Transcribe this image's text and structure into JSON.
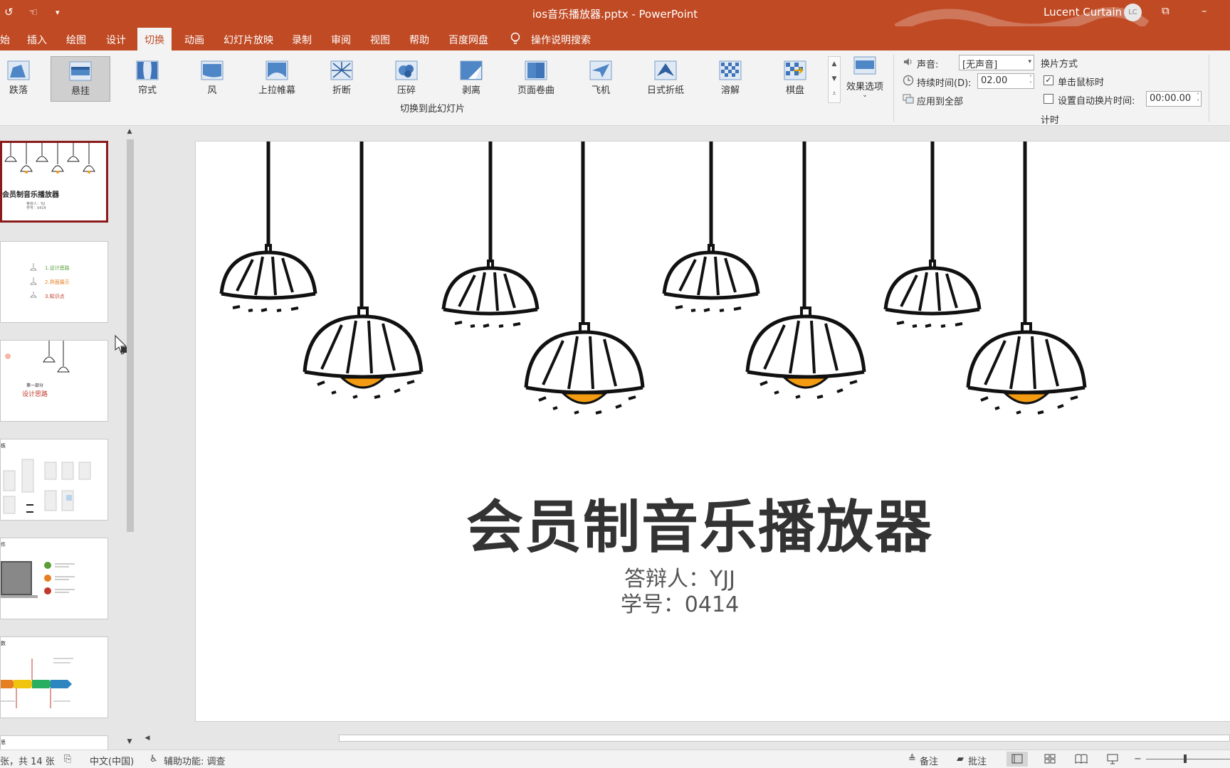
{
  "window": {
    "title": "ios音乐播放器.pptx  -  PowerPoint",
    "user_name": "Lucent Curtain",
    "user_initials": "LC",
    "brand_color": "#c04a24"
  },
  "quick_access": {
    "redo_icon": "redo-icon",
    "touch_mode_icon": "touch-mode-icon",
    "customize_icon": "chevron-down-icon"
  },
  "tabs": [
    {
      "label": "始"
    },
    {
      "label": "插入"
    },
    {
      "label": "绘图"
    },
    {
      "label": "设计"
    },
    {
      "label": "切换"
    },
    {
      "label": "动画"
    },
    {
      "label": "幻灯片放映"
    },
    {
      "label": "录制"
    },
    {
      "label": "审阅"
    },
    {
      "label": "视图"
    },
    {
      "label": "帮助"
    },
    {
      "label": "百度网盘"
    }
  ],
  "active_tab": "切换",
  "tell_me": "操作说明搜索",
  "ribbon": {
    "effects": [
      {
        "label": "跌落"
      },
      {
        "label": "悬挂"
      },
      {
        "label": "帘式"
      },
      {
        "label": "风"
      },
      {
        "label": "上拉帷幕"
      },
      {
        "label": "折断"
      },
      {
        "label": "压碎"
      },
      {
        "label": "剥离"
      },
      {
        "label": "页面卷曲"
      },
      {
        "label": "飞机"
      },
      {
        "label": "日式折纸"
      },
      {
        "label": "溶解"
      },
      {
        "label": "棋盘"
      }
    ],
    "selected_effect": "悬挂",
    "effect_options": "效果选项",
    "group_transition": "切换到此幻灯片",
    "sound_label": "声音:",
    "sound_value": "[无声音]",
    "duration_label": "持续时间(D):",
    "duration_value": "02.00",
    "apply_all": "应用到全部",
    "advance_title": "换片方式",
    "on_click_label": "单击鼠标时",
    "on_click_checked": true,
    "auto_advance_label": "设置自动换片时间:",
    "auto_advance_checked": false,
    "auto_advance_value": "00:00.00",
    "group_timing": "计时"
  },
  "thumbnails": {
    "slide1_title": "会员制音乐播放器",
    "slide1_sub1": "答辩人：YJJ",
    "slide1_sub2": "学号：0414",
    "slide2_item1": "1.设计思路",
    "slide2_item2": "2.界面展示",
    "slide2_item3": "3.知识点",
    "slide3_part": "第一部分",
    "slide3_title": "设计思路",
    "slide4_label": "板",
    "slide5_label": "件",
    "slide6_label": "数",
    "slide7_label": "思"
  },
  "slide": {
    "title": "会员制音乐播放器",
    "presenter": "答辩人：YJJ",
    "student_id": "学号：0414"
  },
  "status": {
    "slide_count": "张，共 14 张",
    "language": "中文(中国)",
    "accessibility": "辅助功能: 调查",
    "notes": "备注",
    "comments": "批注",
    "zoom_minus": "−"
  }
}
